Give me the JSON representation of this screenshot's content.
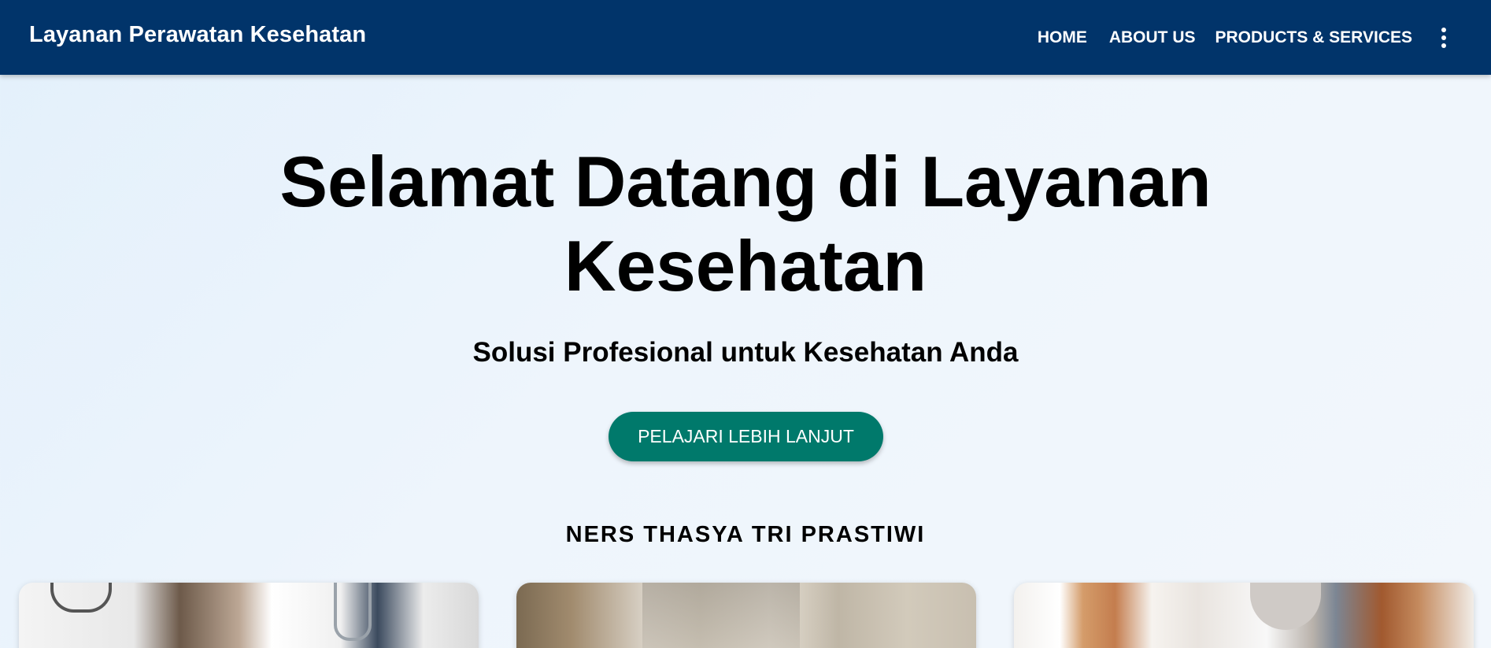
{
  "navbar": {
    "brand": "Layanan Perawatan Kesehatan",
    "links": [
      {
        "label": "HOME"
      },
      {
        "label": "ABOUT US"
      },
      {
        "label": "PRODUCTS & SERVICES"
      }
    ],
    "menu_icon": "more-vert-icon"
  },
  "hero": {
    "title_line1": "Selamat Datang di Layanan",
    "title_line2": "Kesehatan",
    "subtitle": "Solusi Profesional untuk Kesehatan Anda",
    "cta_label": "PELAJARI LEBIH LANJUT"
  },
  "section": {
    "title": "NERS THASYA TRI PRASTIWI"
  },
  "cards": [
    {
      "image": "doctor-with-stethoscope-photo"
    },
    {
      "image": "blood-pressure-cuff-photo"
    },
    {
      "image": "doctor-and-patient-anatomy-model-photo"
    }
  ],
  "colors": {
    "navbar_bg": "#01346a",
    "button_bg": "#00796b",
    "page_bg": "#e8f2fb",
    "text": "#000000"
  }
}
